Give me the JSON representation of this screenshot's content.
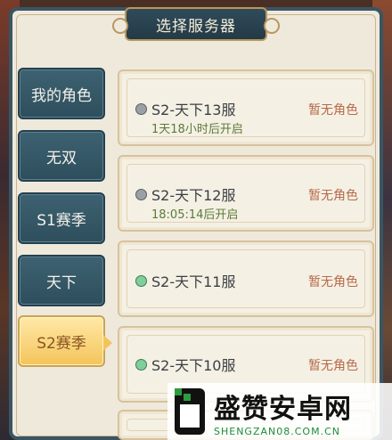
{
  "header": {
    "title": "选择服务器"
  },
  "tabs": [
    {
      "label": "我的角色",
      "active": false
    },
    {
      "label": "无双",
      "active": false
    },
    {
      "label": "S1赛季",
      "active": false
    },
    {
      "label": "天下",
      "active": false
    },
    {
      "label": "S2赛季",
      "active": true
    }
  ],
  "servers": [
    {
      "name": "S2-天下13服",
      "open_time": "1天18小时后开启",
      "role_status": "暂无角色",
      "status_color": "gray"
    },
    {
      "name": "S2-天下12服",
      "open_time": "18:05:14后开启",
      "role_status": "暂无角色",
      "status_color": "gray"
    },
    {
      "name": "S2-天下11服",
      "open_time": "",
      "role_status": "暂无角色",
      "status_color": "green"
    },
    {
      "name": "S2-天下10服",
      "open_time": "",
      "role_status": "暂无角色",
      "status_color": "green"
    }
  ],
  "watermark": {
    "title": "盛赞安卓网",
    "url": "SHENGZAN08.COM.CN"
  },
  "colors": {
    "frame": "#3a5563",
    "tab": "#2e4e5d",
    "tab_active": "#f4c45a",
    "open_time_text": "#5a7a38",
    "role_status_text": "#b56a4a",
    "dot_gray": "#9aa1a6",
    "dot_green": "#7fcf9a"
  }
}
